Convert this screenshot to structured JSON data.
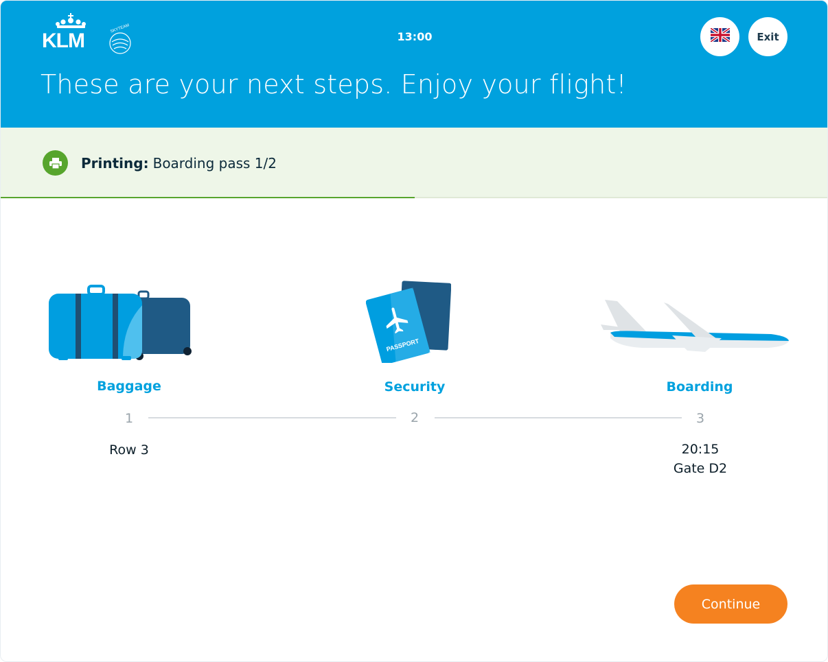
{
  "header": {
    "brand": "KLM",
    "alliance": "SKYTEAM",
    "clock": "13:00",
    "language_icon": "uk-flag-icon",
    "exit_label": "Exit",
    "headline": "These are your next steps. Enjoy your flight!",
    "background_color": "#00a1de"
  },
  "status": {
    "icon": "printer-icon",
    "label": "Printing:",
    "value": "Boarding pass 1/2",
    "progress_fraction": 0.5,
    "accent_color": "#57a52d"
  },
  "steps": [
    {
      "title": "Baggage",
      "number": "1",
      "icon": "suitcase-icon",
      "detail_lines": [
        "Row 3"
      ]
    },
    {
      "title": "Security",
      "number": "2",
      "icon": "passport-icon",
      "detail_lines": []
    },
    {
      "title": "Boarding",
      "number": "3",
      "icon": "airplane-icon",
      "detail_lines": [
        "20:15",
        "Gate D2"
      ]
    }
  ],
  "footer": {
    "continue_label": "Continue",
    "continue_color": "#f58220"
  }
}
